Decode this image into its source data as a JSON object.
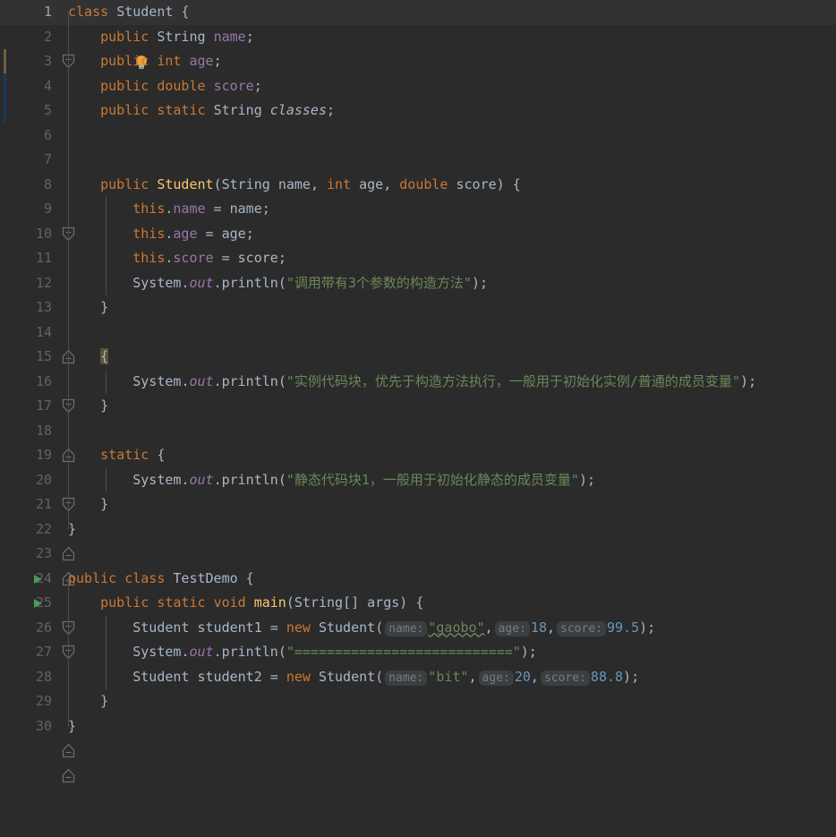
{
  "editor": {
    "language": "Java",
    "theme": "Darcula",
    "background": "#2b2b2b",
    "current_line_background": "#323232",
    "gutter_text_color": "#606366",
    "current_line_number_color": "#a4a3a3",
    "line_count": 30,
    "colors": {
      "keyword": "#cc7832",
      "string": "#6a8759",
      "number": "#6897bb",
      "field": "#9876aa",
      "method": "#ffc66d",
      "default_text": "#a9b7c6",
      "run_marker_green": "#499c54",
      "hint_background": "#3b3f41",
      "hint_text": "#7a7a7a",
      "brace_match_highlight": "#5b5434",
      "changebar_modified": "#6b6040",
      "changebar_added": "#1a3a5c",
      "lightbulb": "#e8a33d"
    }
  },
  "gutter": {
    "line_numbers": [
      1,
      2,
      3,
      4,
      5,
      6,
      7,
      8,
      9,
      10,
      11,
      12,
      13,
      14,
      15,
      16,
      17,
      18,
      19,
      20,
      21,
      22,
      23,
      24,
      25,
      26,
      27,
      28,
      29,
      30
    ],
    "run_marker_lines": [
      24,
      25
    ],
    "fold_open_lines": [
      1,
      8,
      15,
      19,
      24,
      25
    ],
    "fold_close_lines": [
      13,
      17,
      21,
      22,
      29,
      30
    ],
    "lightbulb_line": 2,
    "current_line": 1,
    "changebar_segments": [
      {
        "line": 3,
        "color": "#6b6040",
        "kind": "modified"
      },
      {
        "line": 4,
        "color": "#1a3a5c",
        "kind": "added"
      },
      {
        "line": 5,
        "color": "#1a3a5c",
        "kind": "added"
      }
    ]
  },
  "code": {
    "lines": [
      {
        "n": 1,
        "text": "class Student {"
      },
      {
        "n": 2,
        "text": "    public String name;"
      },
      {
        "n": 3,
        "text": "    public int age;"
      },
      {
        "n": 4,
        "text": "    public double score;"
      },
      {
        "n": 5,
        "text": "    public static String classes;"
      },
      {
        "n": 6,
        "text": ""
      },
      {
        "n": 7,
        "text": ""
      },
      {
        "n": 8,
        "text": "    public Student(String name, int age, double score) {"
      },
      {
        "n": 9,
        "text": "        this.name = name;"
      },
      {
        "n": 10,
        "text": "        this.age = age;"
      },
      {
        "n": 11,
        "text": "        this.score = score;"
      },
      {
        "n": 12,
        "text": "        System.out.println(\"调用带有3个参数的构造方法\");"
      },
      {
        "n": 13,
        "text": "    }"
      },
      {
        "n": 14,
        "text": ""
      },
      {
        "n": 15,
        "text": "    {"
      },
      {
        "n": 16,
        "text": "        System.out.println(\"实例代码块，优先于构造方法执行，一般用于初始化实例/普通的成员变量\");"
      },
      {
        "n": 17,
        "text": "    }"
      },
      {
        "n": 18,
        "text": ""
      },
      {
        "n": 19,
        "text": "    static {"
      },
      {
        "n": 20,
        "text": "        System.out.println(\"静态代码块1，一般用于初始化静态的成员变量\");"
      },
      {
        "n": 21,
        "text": "    }"
      },
      {
        "n": 22,
        "text": "}"
      },
      {
        "n": 23,
        "text": ""
      },
      {
        "n": 24,
        "text": "public class TestDemo {"
      },
      {
        "n": 25,
        "text": "    public static void main(String[] args) {"
      },
      {
        "n": 26,
        "text": "        Student student1 = new Student(\"gaobo\", 18, 99.5);"
      },
      {
        "n": 27,
        "text": "        System.out.println(\"===========================\");"
      },
      {
        "n": 28,
        "text": "        Student student2 = new Student(\"bit\", 20, 88.8);"
      },
      {
        "n": 29,
        "text": "    }"
      },
      {
        "n": 30,
        "text": "}"
      }
    ],
    "strings": {
      "line12": "调用带有3个参数的构造方法",
      "line16": "实例代码块，优先于构造方法执行，一般用于初始化实例/普通的成员变量",
      "line20": "静态代码块1，一般用于初始化静态的成员变量",
      "line27_separator": "==========================="
    },
    "parameter_hints": [
      {
        "line": 26,
        "hints": [
          "name:",
          "age:",
          "score:"
        ],
        "values": [
          "\"gaobo\"",
          "18",
          "99.5"
        ]
      },
      {
        "line": 28,
        "hints": [
          "name:",
          "age:",
          "score:"
        ],
        "values": [
          "\"bit\"",
          "20",
          "88.8"
        ]
      }
    ],
    "identifiers": {
      "class_student": "Student",
      "class_testdemo": "TestDemo",
      "field_name": "name",
      "field_age": "age",
      "field_score": "score",
      "field_classes": "classes",
      "local_student1": "student1",
      "local_student2": "student2",
      "method_main": "main",
      "method_println": "println",
      "stream_out": "out",
      "class_system": "System"
    },
    "tokens": {
      "kw_class": "class",
      "kw_public": "public",
      "kw_static": "static",
      "kw_void": "void",
      "kw_int": "int",
      "kw_double": "double",
      "kw_new": "new",
      "kw_this": "this",
      "type_String": "String"
    }
  }
}
